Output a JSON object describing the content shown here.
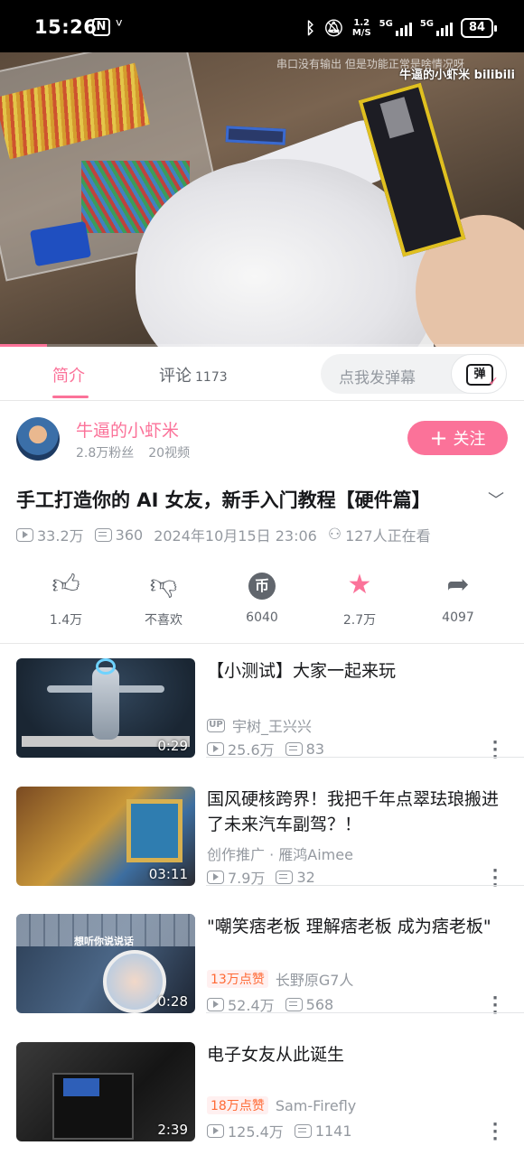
{
  "status_bar": {
    "time": "15:26",
    "n_icon": "N",
    "network_speed_value": "1.2",
    "network_speed_unit": "M/S",
    "sim1": "5G",
    "sim2": "5G",
    "battery": "84"
  },
  "player": {
    "subtitle_overlay": "串口没有输出  但是功能正常是啥情况呀",
    "watermark": "牛逼的小虾米  bilibili",
    "progress_fraction": 0.09
  },
  "tabs": {
    "intro": "简介",
    "comments": "评论",
    "comments_count": "1173",
    "danmu_placeholder": "点我发弹幕",
    "danmu_icon_text": "弹"
  },
  "uploader": {
    "name": "牛逼的小虾米",
    "fans": "2.8万粉丝",
    "videos": "20视频",
    "follow_label": "关注"
  },
  "video": {
    "title": "手工打造你的 AI 女友，新手入门教程【硬件篇】",
    "views": "33.2万",
    "danmaku": "360",
    "date": "2024年10月15日 23:06",
    "watching": "127人正在看"
  },
  "actions": {
    "like": "1.4万",
    "dislike": "不喜欢",
    "coin": "6040",
    "favorite": "2.7万",
    "share": "4097"
  },
  "recommendations": [
    {
      "title": "【小测试】大家一起来玩",
      "author": "宇树_王兴兴",
      "views": "25.6万",
      "danmaku": "83",
      "duration": "0:29"
    },
    {
      "title": "国风硬核跨界！我把千年点翠珐琅搬进了未来汽车副驾？！",
      "author": "创作推广 · 雁鸿Aimee",
      "views": "7.9万",
      "danmaku": "32",
      "duration": "03:11"
    },
    {
      "title": "\"嘲笑痞老板 理解痞老板 成为痞老板\"",
      "badge": "13万点赞",
      "author": "长野原G7人",
      "views": "52.4万",
      "danmaku": "568",
      "duration": "0:28",
      "thumb_text": "想听你说说话"
    },
    {
      "title": "电子女友从此诞生",
      "badge": "18万点赞",
      "author": "Sam-Firefly",
      "views": "125.4万",
      "danmaku": "1141",
      "duration": "2:39"
    }
  ],
  "colors": {
    "accent": "#fb7299",
    "text": "#18191c",
    "muted": "#9499a0",
    "like_badge": "#ff6a35"
  }
}
